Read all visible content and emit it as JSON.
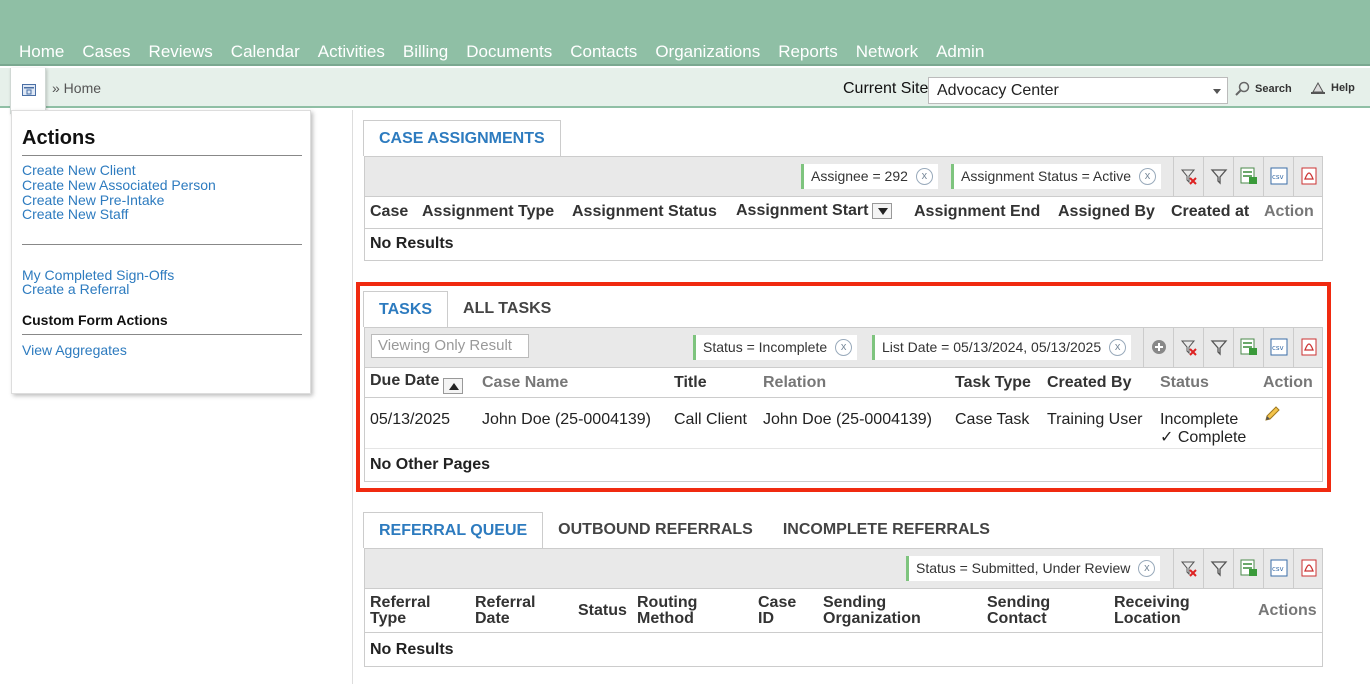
{
  "nav": [
    "Home",
    "Cases",
    "Reviews",
    "Calendar",
    "Activities",
    "Billing",
    "Documents",
    "Contacts",
    "Organizations",
    "Reports",
    "Network",
    "Admin"
  ],
  "breadcrumb": "» Home",
  "site": {
    "label": "Current Site",
    "value": "Advocacy Center"
  },
  "search_label": "Search",
  "help_label": "Help",
  "actions": {
    "title": "Actions",
    "links1": [
      "Create New Client",
      "Create New Associated Person",
      "Create New Pre-Intake",
      "Create New Staff"
    ],
    "links2": [
      "My Completed Sign-Offs",
      "Create a Referral"
    ],
    "custom_title": "Custom Form Actions",
    "links3": [
      "View Aggregates"
    ]
  },
  "case_assignments": {
    "tab": "CASE ASSIGNMENTS",
    "filters": [
      "Assignee = 292",
      "Assignment Status = Active"
    ],
    "columns": [
      "Case",
      "Assignment Type",
      "Assignment Status",
      "Assignment Start",
      "Assignment End",
      "Assigned By",
      "Created at",
      "Action"
    ],
    "empty": "No Results"
  },
  "tasks": {
    "tabs": [
      "TASKS",
      "ALL TASKS"
    ],
    "viewing_placeholder": "Viewing Only Result",
    "filters": [
      "Status = Incomplete",
      "List Date = 05/13/2024, 05/13/2025"
    ],
    "columns": [
      "Due Date",
      "Case Name",
      "Title",
      "Relation",
      "Task Type",
      "Created By",
      "Status",
      "Action"
    ],
    "rows": [
      {
        "due_date": "05/13/2025",
        "case_name": "John Doe (25-0004139)",
        "title": "Call Client",
        "relation": "John Doe (25-0004139)",
        "task_type": "Case Task",
        "created_by": "Training User",
        "status": "Incomplete",
        "complete_link": "✓ Complete"
      }
    ],
    "footer": "No Other Pages"
  },
  "referrals": {
    "tabs": [
      "REFERRAL QUEUE",
      "OUTBOUND REFERRALS",
      "INCOMPLETE REFERRALS"
    ],
    "filters": [
      "Status = Submitted, Under Review"
    ],
    "columns": [
      [
        "Referral",
        "Type"
      ],
      [
        "Referral",
        "Date"
      ],
      [
        "Status"
      ],
      [
        "Routing",
        "Method"
      ],
      [
        "Case",
        "ID"
      ],
      [
        "Sending",
        "Organization"
      ],
      [
        "Sending",
        "Contact"
      ],
      [
        "Receiving",
        "Location"
      ],
      [
        "Actions"
      ]
    ],
    "empty": "No Results"
  },
  "colors": {
    "nav_bg": "#8fbfa5",
    "link": "#2d7bbf",
    "highlight": "#f02a10"
  }
}
